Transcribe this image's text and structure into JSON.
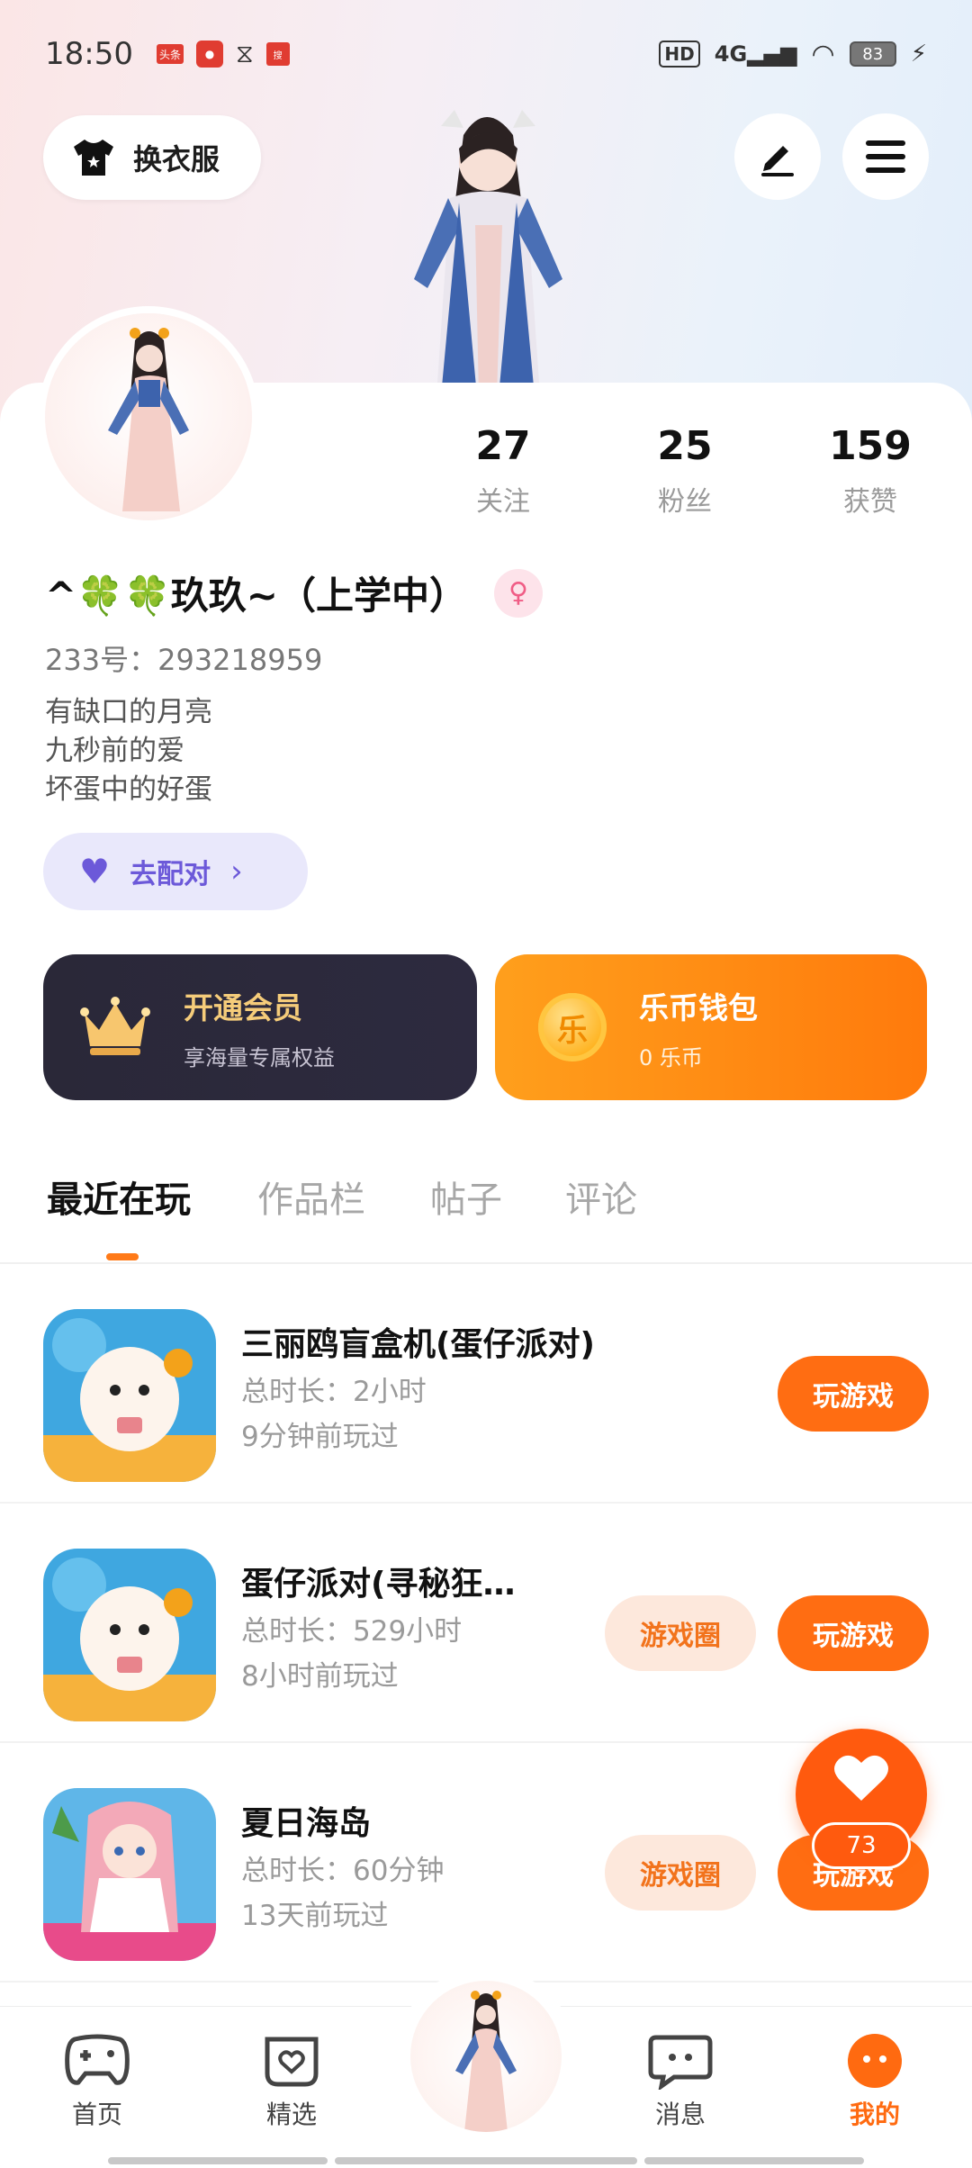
{
  "status_bar": {
    "time": "18:50",
    "network": "4G",
    "hd_label": "HD",
    "battery": "83"
  },
  "header": {
    "outfit_label": "换衣服"
  },
  "profile": {
    "stats": [
      {
        "num": "27",
        "label": "关注"
      },
      {
        "num": "25",
        "label": "粉丝"
      },
      {
        "num": "159",
        "label": "获赞"
      }
    ],
    "name": "^🍀🍀玖玖~（上学中）",
    "gender_icon": "female-icon",
    "uid": "233号：293218959",
    "bio": [
      "有缺口的月亮",
      "九秒前的爱",
      "坏蛋中的好蛋"
    ],
    "match_label": "去配对"
  },
  "promo": {
    "vip_title": "开通会员",
    "vip_sub": "享海量专属权益",
    "wallet_title": "乐币钱包",
    "wallet_sub": "0 乐币",
    "coin_glyph": "乐"
  },
  "tabs": [
    {
      "label": "最近在玩",
      "active": true
    },
    {
      "label": "作品栏",
      "active": false
    },
    {
      "label": "帖子",
      "active": false
    },
    {
      "label": "评论",
      "active": false
    }
  ],
  "games": [
    {
      "title": "三丽鸥盲盒机(蛋仔派对)",
      "duration": "总时长：2小时",
      "last_played": "9分钟前玩过",
      "play_label": "玩游戏",
      "circle_label": ""
    },
    {
      "title": "蛋仔派对(寻秘狂…",
      "duration": "总时长：529小时",
      "last_played": "8小时前玩过",
      "play_label": "玩游戏",
      "circle_label": "游戏圈"
    },
    {
      "title": "夏日海岛",
      "duration": "总时长：60分钟",
      "last_played": "13天前玩过",
      "play_label": "玩游戏",
      "circle_label": "游戏圈"
    }
  ],
  "floating_like": {
    "count": "73"
  },
  "bottom_nav": [
    {
      "label": "首页",
      "icon": "gamepad-icon"
    },
    {
      "label": "精选",
      "icon": "heart-box-icon"
    },
    {
      "label": "消息",
      "icon": "chat-icon"
    },
    {
      "label": "我的",
      "icon": "face-icon"
    }
  ],
  "colors": {
    "accent": "#ff6d12",
    "match": "#6c59d9",
    "vip_gold": "#f5cc7a"
  }
}
